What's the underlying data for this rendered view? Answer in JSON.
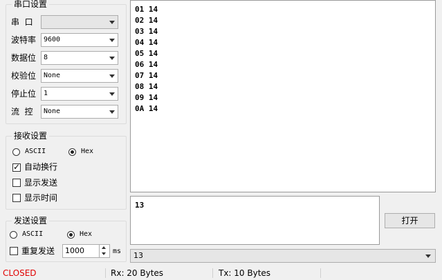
{
  "serial_settings": {
    "title": "串口设置",
    "port": {
      "label": "串  口",
      "value": ""
    },
    "baud": {
      "label": "波特率",
      "value": "9600"
    },
    "data_bits": {
      "label": "数据位",
      "value": "8"
    },
    "parity": {
      "label": "校验位",
      "value": "None"
    },
    "stop_bits": {
      "label": "停止位",
      "value": "1"
    },
    "flow": {
      "label": "流  控",
      "value": "None"
    }
  },
  "receive_settings": {
    "title": "接收设置",
    "ascii_label": "ASCII",
    "hex_label": "Hex",
    "auto_wrap_label": "自动换行",
    "show_send_label": "显示发送",
    "show_time_label": "显示时间"
  },
  "send_settings": {
    "title": "发送设置",
    "ascii_label": "ASCII",
    "hex_label": "Hex",
    "repeat_label": "重复发送",
    "interval_value": "1000",
    "interval_unit": "ms"
  },
  "receive_lines": [
    "01 14",
    "02 14",
    "03 14",
    "04 14",
    "05 14",
    "06 14",
    "07 14",
    "08 14",
    "09 14",
    "0A 14"
  ],
  "send_text": "13",
  "open_button": "打开",
  "history_value": "13",
  "status": {
    "state": "CLOSED",
    "rx": "Rx: 20 Bytes",
    "tx": "Tx: 10 Bytes",
    "state_color": "#e00000"
  }
}
